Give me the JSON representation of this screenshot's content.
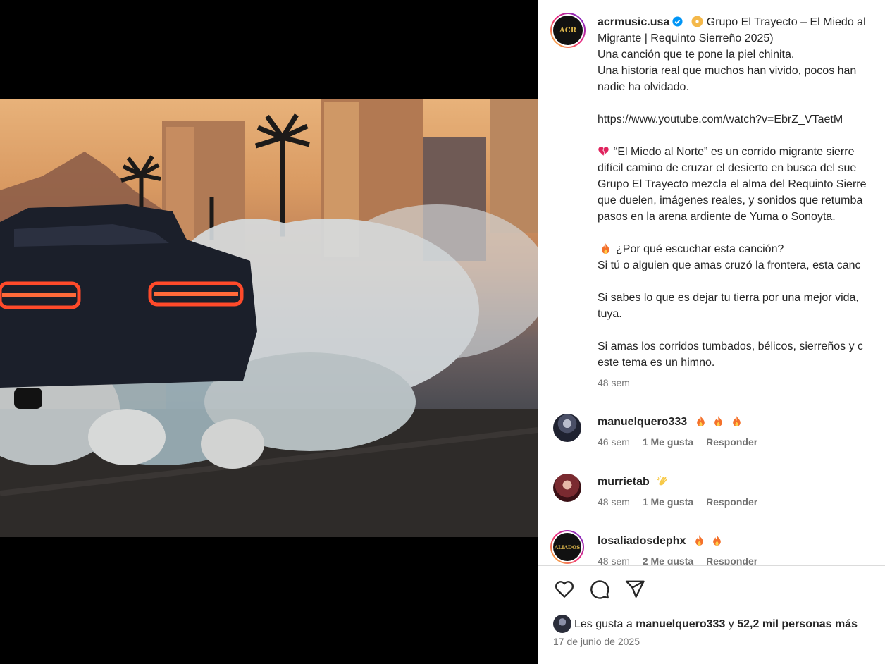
{
  "post": {
    "username": "acrmusic.usa",
    "avatar_text": "ACR",
    "caption_lines": [
      "Grupo El Trayecto – El Miedo al",
      "Migrante | Requinto Sierreño 2025)",
      "Una canción que te pone la piel chinita.",
      "Una historia real que muchos han vivido, pocos han",
      "nadie ha olvidado.",
      "https://www.youtube.com/watch?v=EbrZ_VTaetM",
      "“El Miedo al Norte” es un corrido migrante sierre",
      "difícil camino de cruzar el desierto en busca del sue",
      "Grupo El Trayecto mezcla el alma del Requinto Sierre",
      "que duelen, imágenes reales, y sonidos que retumba",
      "pasos en la arena ardiente de Yuma o Sonoyta.",
      "¿Por qué escuchar esta canción?",
      "Si tú o alguien que amas cruzó la frontera, esta canc",
      "Si sabes lo que es dejar tu tierra por una mejor vida,",
      "tuya.",
      "Si amas los corridos tumbados, bélicos, sierreños y c",
      "este tema es un himno."
    ],
    "caption_time": "48 sem"
  },
  "comments": [
    {
      "username": "manuelquero333",
      "emojis": "fire,fire,fire",
      "time": "46 sem",
      "likes": "1 Me gusta",
      "reply": "Responder"
    },
    {
      "username": "murrietab",
      "emojis": "clap",
      "time": "48 sem",
      "likes": "1 Me gusta",
      "reply": "Responder"
    },
    {
      "username": "losaliadosdephx",
      "emojis": "fire,fire",
      "time": "48 sem",
      "likes": "2 Me gusta",
      "reply": "Responder",
      "avatar_text": "ALIADOS"
    }
  ],
  "footer": {
    "likes_prefix": "Les gusta a",
    "likes_user": "manuelquero333",
    "likes_and": "y",
    "likes_count": "52,2 mil personas más",
    "date": "17 de junio de 2025"
  },
  "icons": {
    "like": "heart-icon",
    "comment": "comment-icon",
    "share": "share-icon",
    "mute": "speaker-muted-icon",
    "verified": "verified-badge-icon"
  },
  "colors": {
    "text": "#262626",
    "muted": "#737373",
    "verified": "#0095f6",
    "divider": "#dbdbdb"
  }
}
